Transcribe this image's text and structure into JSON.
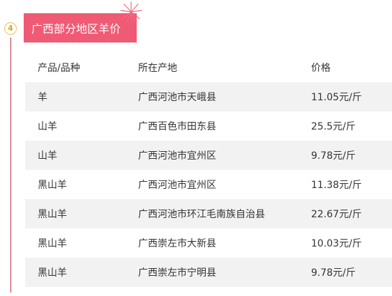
{
  "section": {
    "step_number": "4",
    "title": "广西部分地区羊价"
  },
  "table": {
    "headers": [
      "产品/品种",
      "所在产地",
      "价格"
    ],
    "rows": [
      [
        "羊",
        "广西河池市天峨县",
        "11.05元/斤"
      ],
      [
        "山羊",
        "广西百色市田东县",
        "25.5元/斤"
      ],
      [
        "山羊",
        "广西河池市宜州区",
        "9.78元/斤"
      ],
      [
        "黑山羊",
        "广西河池市宜州区",
        "11.38元/斤"
      ],
      [
        "黑山羊",
        "广西河池市环江毛南族自治县",
        "22.67元/斤"
      ],
      [
        "黑山羊",
        "广西崇左市大新县",
        "10.03元/斤"
      ],
      [
        "黑山羊",
        "广西崇左市宁明县",
        "9.78元/斤"
      ]
    ]
  },
  "colors": {
    "accent": "#ef5a75",
    "rail": "#c62d45",
    "badge": "#e8c25a",
    "row_shade": "#f2f2f2"
  }
}
